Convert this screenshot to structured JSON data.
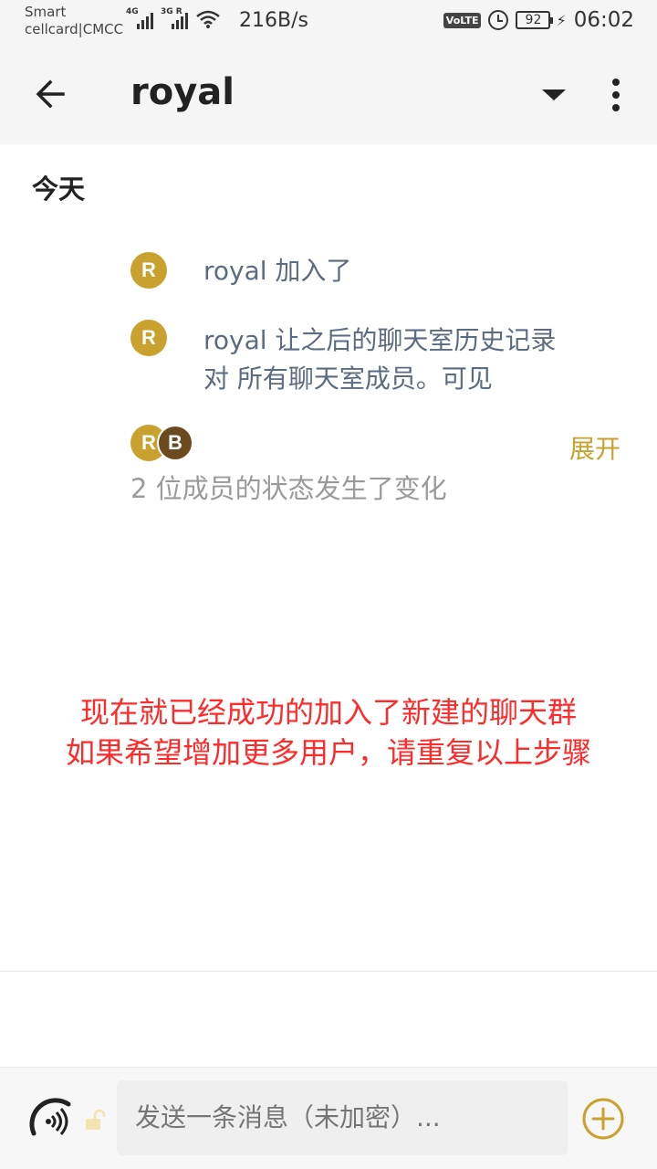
{
  "status_bar": {
    "carrier_line1": "Smart",
    "carrier_line2": "cellcard|CMCC",
    "signal1_tag": "4G",
    "signal2_tag": "3G R",
    "net_speed": "216B/s",
    "volte": "VoLTE",
    "battery": "92",
    "time": "06:02"
  },
  "app_bar": {
    "title": "royal",
    "icons": [
      "back-arrow-icon",
      "dropdown-icon",
      "more-vert-icon"
    ]
  },
  "timeline": {
    "date_header": "今天",
    "events": [
      {
        "avatar": "R",
        "text": "royal 加入了"
      },
      {
        "avatar": "R",
        "text_line1": "royal 让之后的聊天室历史记录",
        "text_line2": "对 所有聊天室成员。可见"
      }
    ],
    "member_change": {
      "avatars": [
        "R",
        "B"
      ],
      "expand_label": "展开",
      "summary": "2 位成员的状态发生了变化"
    }
  },
  "annotation": {
    "line1": "现在就已经成功的加入了新建的聊天群",
    "line2": "如果希望增加更多用户，请重复以上步骤"
  },
  "composer": {
    "placeholder": "发送一条消息（未加密）..."
  },
  "colors": {
    "accent": "#c9a12f",
    "avatar_r": "#c9a12f",
    "avatar_b": "#6b4a1d",
    "event_text": "#5b6b80",
    "annotation": "#ff2a2a"
  }
}
